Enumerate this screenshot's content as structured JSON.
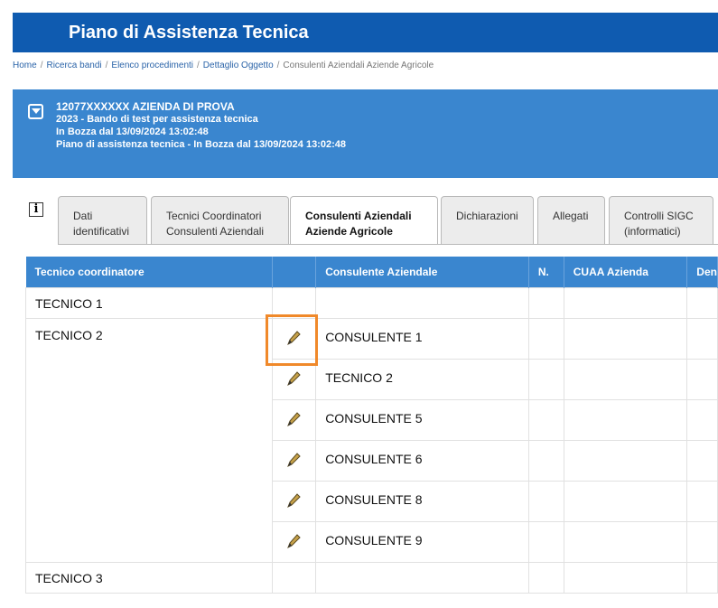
{
  "app": {
    "title": "Piano di Assistenza Tecnica"
  },
  "breadcrumb": {
    "items": [
      "Home",
      "Ricerca bandi",
      "Elenco procedimenti",
      "Dettaglio Oggetto"
    ],
    "current": "Consulenti Aziendali Aziende Agricole"
  },
  "info": {
    "line1": "12077XXXXXX AZIENDA DI PROVA",
    "line2": "2023 - Bando di test per assistenza tecnica",
    "line3": "In Bozza dal 13/09/2024 13:02:48",
    "line4": "Piano di assistenza tecnica - In Bozza dal 13/09/2024 13:02:48"
  },
  "info_icon": "info-icon",
  "tabs": [
    {
      "line1": "Dati",
      "line2": "identificativi"
    },
    {
      "line1": "Tecnici Coordinatori",
      "line2": "Consulenti Aziendali"
    },
    {
      "line1": "Consulenti Aziendali",
      "line2": "Aziende Agricole",
      "active": true
    },
    {
      "line1": "Dichiarazioni",
      "line2": ""
    },
    {
      "line1": "Allegati",
      "line2": ""
    },
    {
      "line1": "Controlli SIGC",
      "line2": "(informatici)"
    }
  ],
  "table": {
    "headers": [
      "Tecnico coordinatore",
      "",
      "Consulente Aziendale",
      "N.",
      "CUAA Azienda",
      "Den"
    ],
    "rows": [
      {
        "coordinatore": "TECNICO 1"
      },
      {
        "coordinatore": "TECNICO 2",
        "consulenti": [
          "CONSULENTE 1",
          "TECNICO 2",
          "CONSULENTE 5",
          "CONSULENTE 6",
          "CONSULENTE 8",
          "CONSULENTE 9"
        ]
      },
      {
        "coordinatore": "TECNICO 3"
      }
    ]
  },
  "colors": {
    "header_blue": "#0f5bb0",
    "info_blue": "#3a86cf",
    "highlight": "#f0892a"
  },
  "edit_icon": "pencil-icon"
}
